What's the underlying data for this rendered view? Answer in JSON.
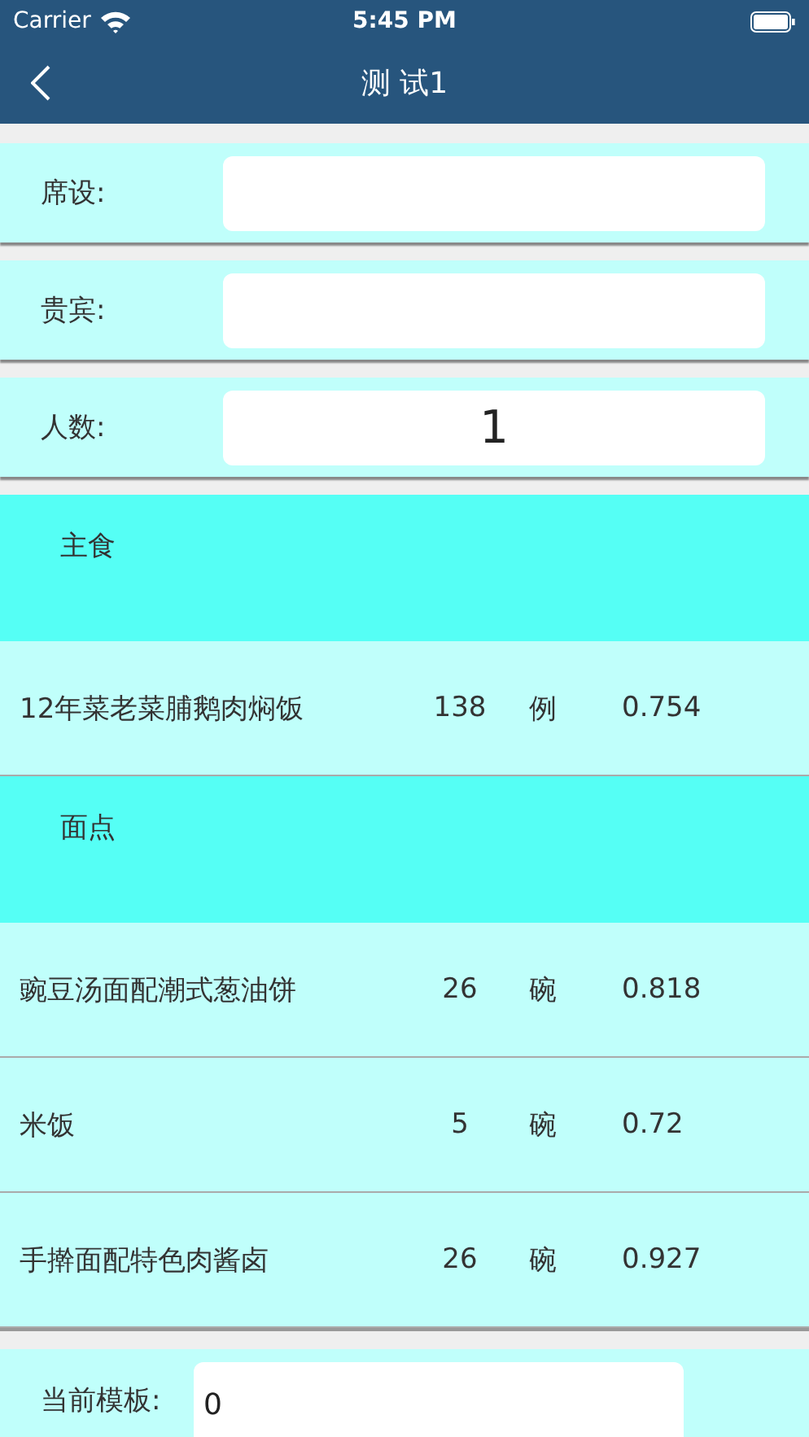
{
  "status_bar": {
    "carrier": "Carrier",
    "time": "5:45 PM"
  },
  "nav": {
    "title": "测 试1"
  },
  "fields": [
    {
      "label": "席设:"
    },
    {
      "label": "贵宾:"
    },
    {
      "label": "人数:",
      "value": "1"
    }
  ],
  "sections": [
    {
      "title": "主食",
      "items": [
        {
          "name": "12年菜老菜脯鹅肉焖饭",
          "quantity": "138",
          "unit": "例",
          "price": "0.754"
        }
      ]
    },
    {
      "title": "面点",
      "items": [
        {
          "name": "豌豆汤面配潮式葱油饼",
          "quantity": "26",
          "unit": "碗",
          "price": "0.818"
        },
        {
          "name": "米饭",
          "quantity": "5",
          "unit": "碗",
          "price": "0.72"
        },
        {
          "name": "手擀面配特色肉酱卤",
          "quantity": "26",
          "unit": "碗",
          "price": "0.927"
        }
      ]
    }
  ],
  "template": {
    "label": "当前模板:",
    "value": "0"
  }
}
